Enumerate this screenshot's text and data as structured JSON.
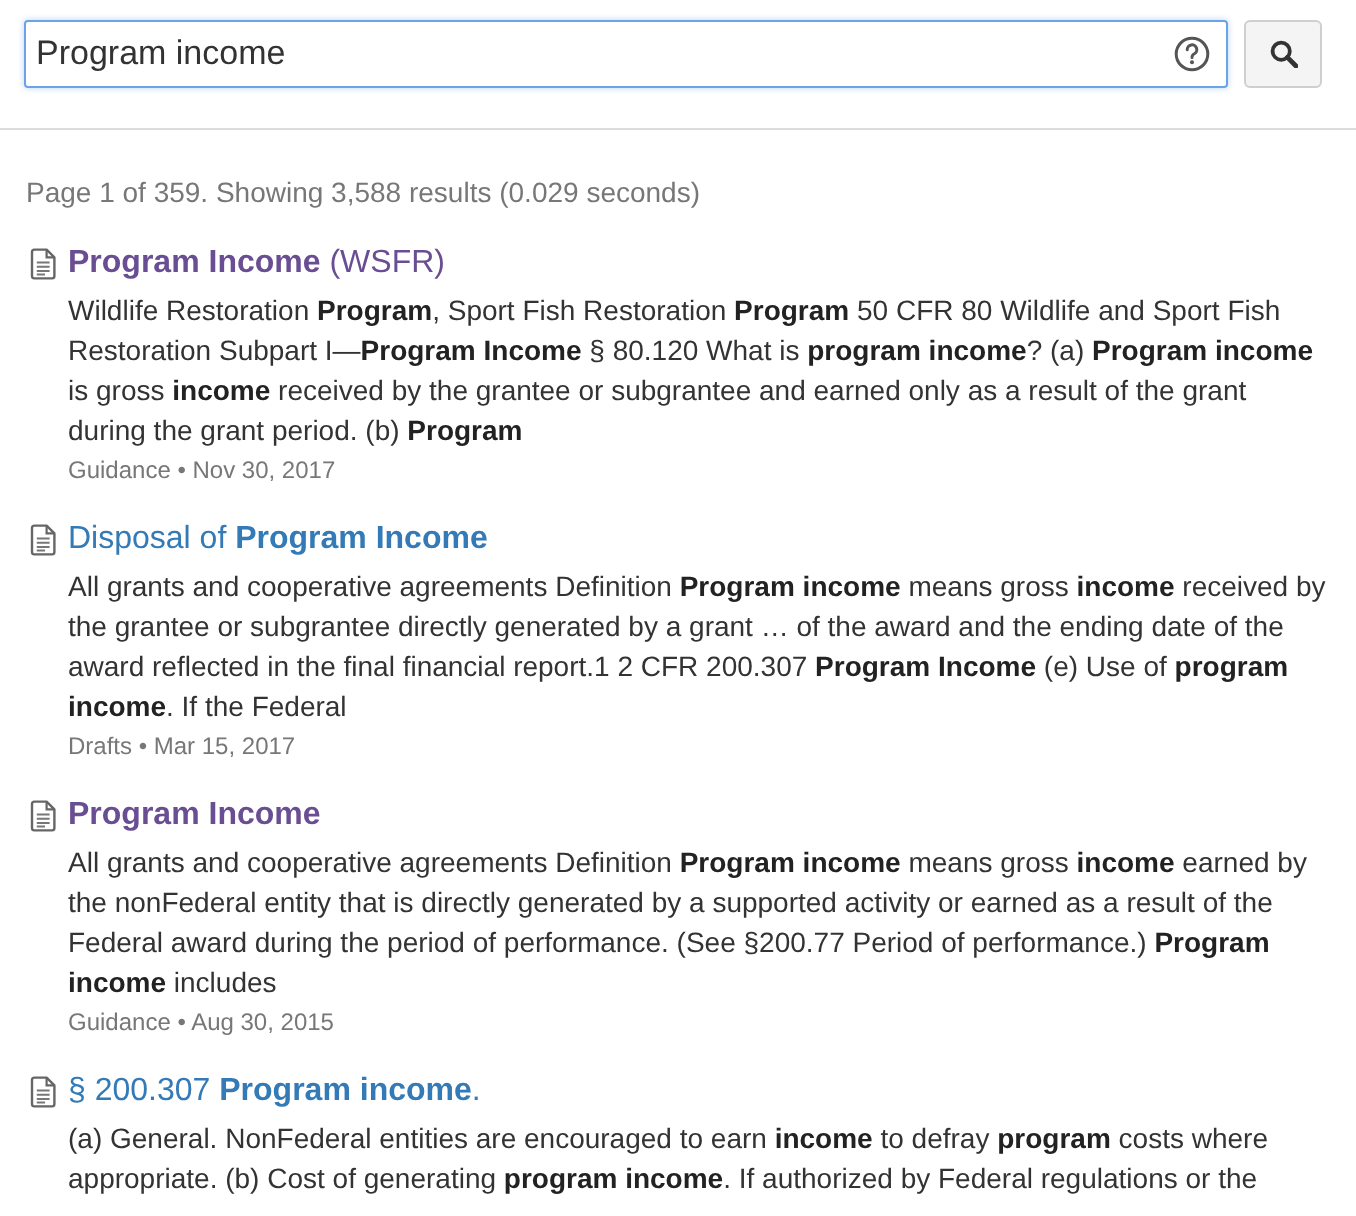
{
  "search": {
    "value": "Program income"
  },
  "summary": "Page 1 of 359. Showing 3,588 results (0.029 seconds)",
  "results": [
    {
      "title": "**Program Income** (WSFR)",
      "title_bold": false,
      "visited": true,
      "snippet": "Wildlife Restoration **Program**, Sport Fish Restoration **Program** 50 CFR 80 Wildlife and Sport Fish Restoration Subpart I—**Program Income** § 80.120 What is **program income**? (a) **Program income** is gross **income** received by the grantee or subgrantee and earned only as a result of the grant during the grant period. (b) **Program**",
      "meta": "Guidance • Nov 30, 2017"
    },
    {
      "title": "Disposal of **Program Income**",
      "title_bold": false,
      "visited": false,
      "snippet": "All grants and cooperative agreements Definition **Program income** means gross **income** received by the grantee or subgrantee directly generated by a grant … of the award and the ending date of the award reflected in the final financial report.1 2 CFR 200.307 **Program Income** (e) Use of **program income**. If the Federal",
      "meta": "Drafts • Mar 15, 2017"
    },
    {
      "title": "Program Income",
      "title_bold": true,
      "visited": true,
      "snippet": "All grants and cooperative agreements Definition **Program income** means gross **income** earned by the nonFederal entity that is directly generated by a supported activity or earned as a result of the Federal award during the period of performance. (See §200.77 Period of performance.) **Program income** includes",
      "meta": "Guidance • Aug 30, 2015"
    },
    {
      "title": "§ 200.307 **Program income**.",
      "title_bold": false,
      "visited": false,
      "snippet": "(a) General. NonFederal entities are encouraged to earn **income** to defray **program** costs where appropriate. (b) Cost of generating **program income**. If authorized by Federal regulations or the"
    }
  ]
}
